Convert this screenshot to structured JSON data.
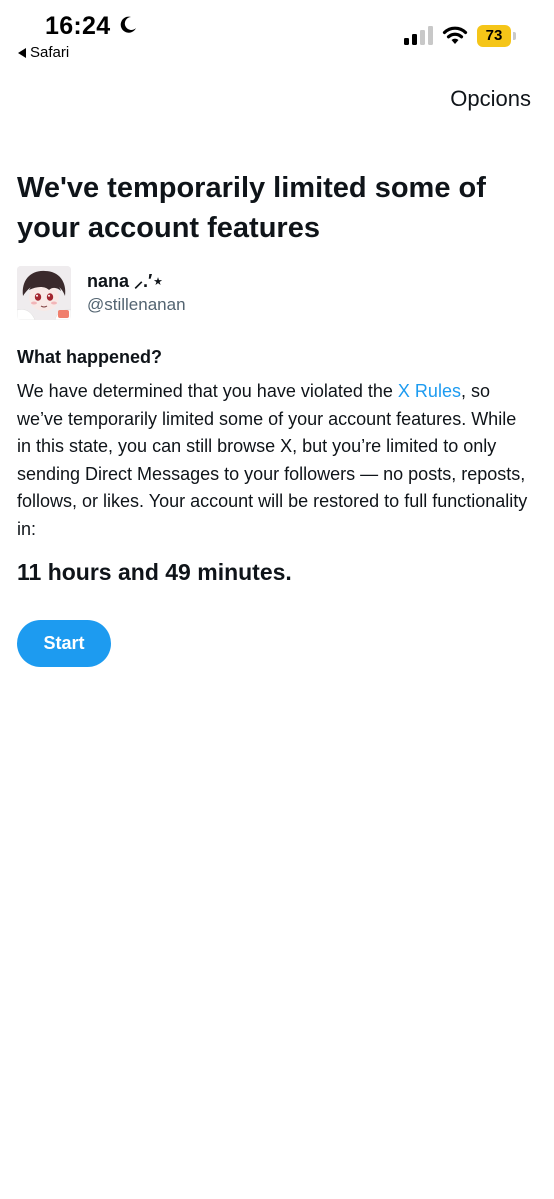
{
  "status_bar": {
    "time": "16:24",
    "back_app": "Safari",
    "battery": "73",
    "icons": [
      "moon-icon",
      "signal-icon",
      "wifi-icon",
      "battery-icon"
    ]
  },
  "top_bar": {
    "options_label": "Opcions"
  },
  "main": {
    "title": "We've temporarily limited some of your account features",
    "account": {
      "display_name": "nana ⸝.′⋆",
      "handle": "@stillenanan"
    },
    "section_heading": "What happened?",
    "body_before_link": "We have determined that you have violated the ",
    "rules_link": "X Rules",
    "body_after_link": ", so we’ve temporarily limited some of your account features. While in this state, you can still browse X, but you’re limited to only sending Direct Messages to your followers — no posts, reposts, follows, or likes. Your account will be restored to full functionality in:",
    "countdown": "11 hours and 49 minutes.",
    "start_label": "Start"
  },
  "colors": {
    "accent": "#1d9bf0",
    "text": "#0f1419",
    "secondary_text": "#536471",
    "battery_badge": "#f5c518"
  }
}
